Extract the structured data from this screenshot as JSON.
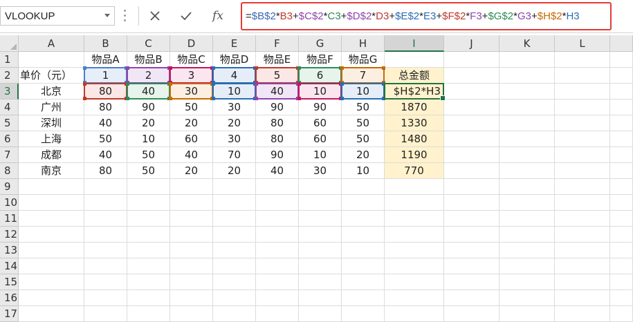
{
  "name_box": {
    "value": "VLOOKUP"
  },
  "formula_bar": {
    "cancel_icon": "close-icon",
    "enter_icon": "check-icon",
    "function_icon": "fx-icon",
    "fx_label": "fx",
    "tokens": [
      {
        "t": "=",
        "c": "#222222"
      },
      {
        "t": "$B$2",
        "c": "#3b6ab5"
      },
      {
        "t": "*",
        "c": "#222222"
      },
      {
        "t": "B3",
        "c": "#c0392b"
      },
      {
        "t": "+",
        "c": "#222222"
      },
      {
        "t": "$C$2",
        "c": "#8e44ad"
      },
      {
        "t": "*",
        "c": "#222222"
      },
      {
        "t": "C3",
        "c": "#2e8b57"
      },
      {
        "t": "+",
        "c": "#222222"
      },
      {
        "t": "$D$2",
        "c": "#8e44ad"
      },
      {
        "t": "*",
        "c": "#222222"
      },
      {
        "t": "D3",
        "c": "#c0392b"
      },
      {
        "t": "+",
        "c": "#222222"
      },
      {
        "t": "$E$2",
        "c": "#2a6db3"
      },
      {
        "t": "*",
        "c": "#222222"
      },
      {
        "t": "E3",
        "c": "#2a6db3"
      },
      {
        "t": "+",
        "c": "#222222"
      },
      {
        "t": "$F$2",
        "c": "#c0392b"
      },
      {
        "t": "*",
        "c": "#222222"
      },
      {
        "t": "F3",
        "c": "#8e44ad"
      },
      {
        "t": "+",
        "c": "#222222"
      },
      {
        "t": "$G$2",
        "c": "#2e8b57"
      },
      {
        "t": "*",
        "c": "#222222"
      },
      {
        "t": "G3",
        "c": "#8e44ad"
      },
      {
        "t": "+",
        "c": "#222222"
      },
      {
        "t": "$H$2",
        "c": "#c66a00"
      },
      {
        "t": "*",
        "c": "#222222"
      },
      {
        "t": "H3",
        "c": "#2a6db3"
      }
    ]
  },
  "columns": [
    "A",
    "B",
    "C",
    "D",
    "E",
    "F",
    "G",
    "H",
    "I",
    "J",
    "K",
    "L"
  ],
  "rows": [
    "1",
    "2",
    "3",
    "4",
    "5",
    "6",
    "7",
    "8",
    "9",
    "10",
    "11",
    "12",
    "13",
    "14",
    "15",
    "16",
    "17"
  ],
  "sheet": {
    "header_row": [
      "",
      "物品A",
      "物品B",
      "物品C",
      "物品D",
      "物品E",
      "物品F",
      "物品G",
      ""
    ],
    "price_row": [
      "单价（元）",
      "1",
      "2",
      "3",
      "4",
      "5",
      "6",
      "7",
      "总金额"
    ],
    "data_rows": [
      [
        "北京",
        "80",
        "40",
        "30",
        "10",
        "40",
        "10",
        "10",
        "$H$2*H3"
      ],
      [
        "广州",
        "80",
        "90",
        "50",
        "30",
        "90",
        "90",
        "50",
        "1870"
      ],
      [
        "深圳",
        "40",
        "20",
        "20",
        "20",
        "80",
        "60",
        "50",
        "1330"
      ],
      [
        "上海",
        "50",
        "10",
        "60",
        "30",
        "80",
        "60",
        "50",
        "1480"
      ],
      [
        "成都",
        "40",
        "50",
        "40",
        "70",
        "90",
        "10",
        "20",
        "1190"
      ],
      [
        "南京",
        "80",
        "50",
        "20",
        "20",
        "40",
        "30",
        "10",
        "770"
      ]
    ]
  },
  "colors": {
    "accent": "#217346",
    "formula_border": "#e53935",
    "total_fill": "#fff2cc"
  }
}
